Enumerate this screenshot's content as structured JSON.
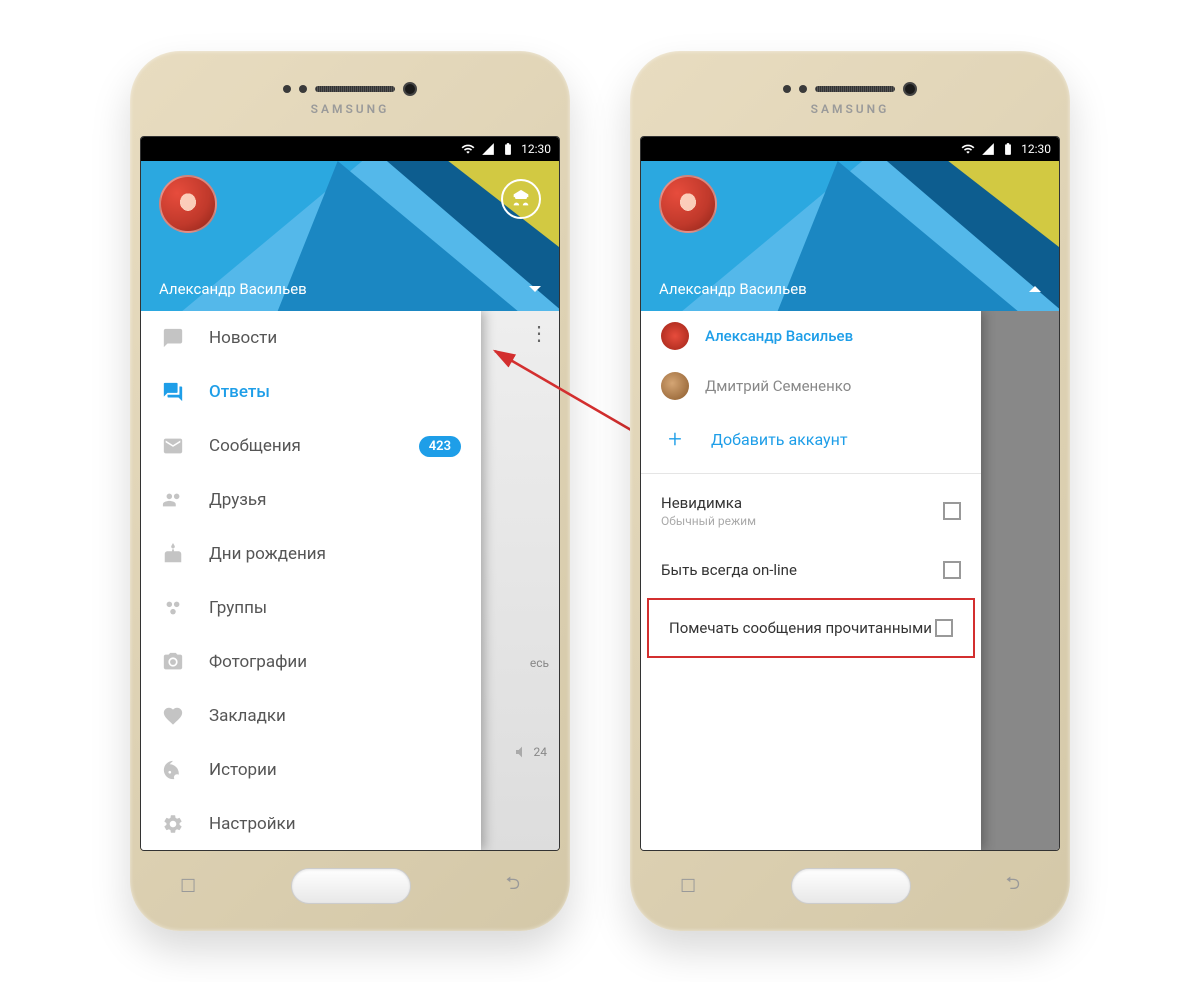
{
  "brand": "SAMSUNG",
  "status": {
    "time": "12:30"
  },
  "header": {
    "user_name": "Александр Васильев"
  },
  "phone1": {
    "menu": [
      {
        "icon": "news-icon",
        "label": "Новости"
      },
      {
        "icon": "replies-icon",
        "label": "Ответы",
        "active": true
      },
      {
        "icon": "messages-icon",
        "label": "Сообщения",
        "badge": "423"
      },
      {
        "icon": "friends-icon",
        "label": "Друзья"
      },
      {
        "icon": "birthday-icon",
        "label": "Дни рождения"
      },
      {
        "icon": "groups-icon",
        "label": "Группы"
      },
      {
        "icon": "photos-icon",
        "label": "Фотографии"
      },
      {
        "icon": "bookmarks-icon",
        "label": "Закладки"
      },
      {
        "icon": "stories-icon",
        "label": "Истории"
      },
      {
        "icon": "settings-icon",
        "label": "Настройки"
      }
    ],
    "behind": {
      "count": "24"
    }
  },
  "phone2": {
    "accounts": {
      "primary": "Александр Васильев",
      "secondary": "Дмитрий Семененко",
      "add_label": "Добавить аккаунт"
    },
    "settings": {
      "invisible": {
        "title": "Невидимка",
        "sub": "Обычный режим"
      },
      "always_online": {
        "title": "Быть всегда on-line"
      },
      "mark_read": {
        "title": "Помечать сообщения прочитанными"
      }
    }
  }
}
